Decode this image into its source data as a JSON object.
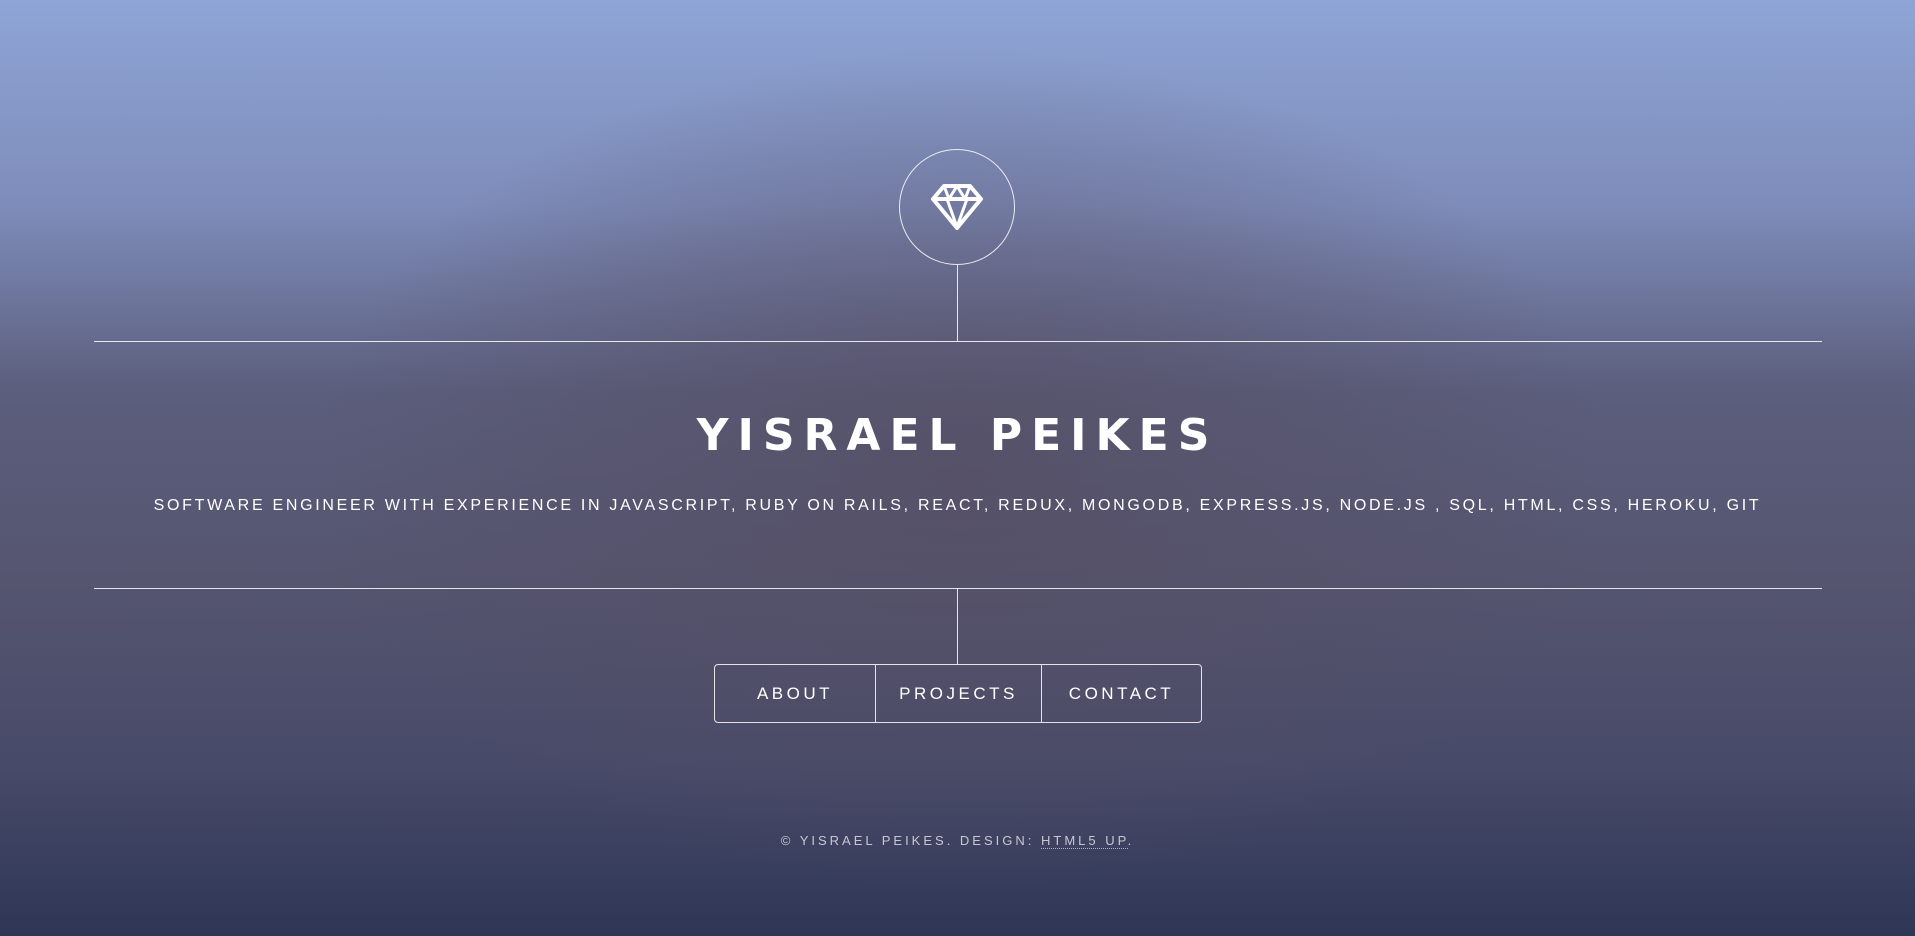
{
  "header": {
    "logo_icon": "diamond-icon",
    "title": "YISRAEL PEIKES",
    "subtitle": "SOFTWARE ENGINEER WITH EXPERIENCE IN JAVASCRIPT, RUBY ON RAILS, REACT, REDUX, MONGODB, EXPRESS.JS, NODE.JS , SQL, HTML, CSS, HEROKU, GIT"
  },
  "nav": {
    "items": [
      {
        "label": "ABOUT"
      },
      {
        "label": "PROJECTS"
      },
      {
        "label": "CONTACT"
      }
    ]
  },
  "footer": {
    "copyright": "© YISRAEL PEIKES. DESIGN: ",
    "design_link": "HTML5 UP",
    "trailing": "."
  },
  "colors": {
    "text": "#ffffff",
    "bg_top": "#8ea5d6",
    "bg_bottom": "#2e3656"
  }
}
